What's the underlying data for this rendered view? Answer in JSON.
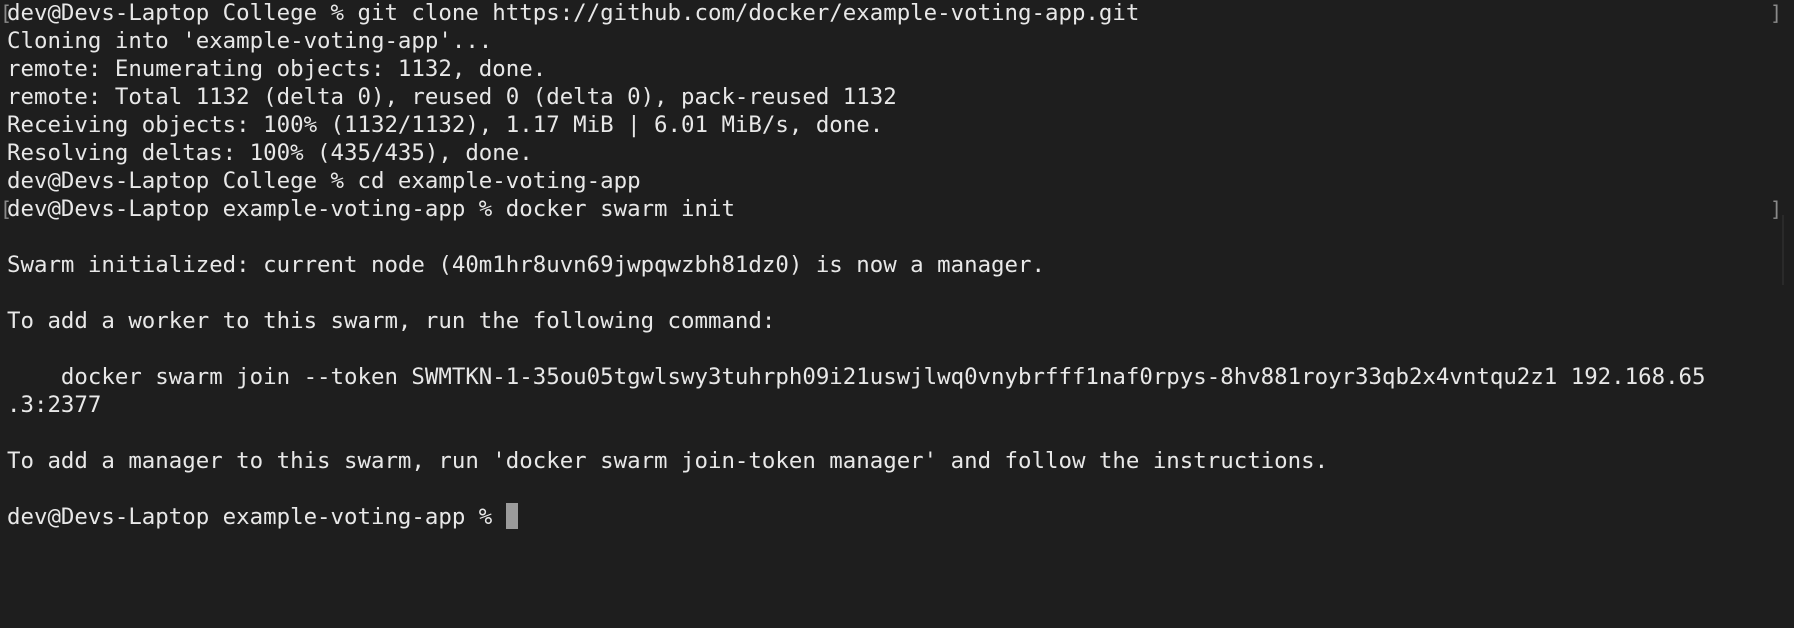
{
  "terminal": {
    "lines": [
      "dev@Devs-Laptop College % git clone https://github.com/docker/example-voting-app.git",
      "Cloning into 'example-voting-app'...",
      "remote: Enumerating objects: 1132, done.",
      "remote: Total 1132 (delta 0), reused 0 (delta 0), pack-reused 1132",
      "Receiving objects: 100% (1132/1132), 1.17 MiB | 6.01 MiB/s, done.",
      "Resolving deltas: 100% (435/435), done.",
      "dev@Devs-Laptop College % cd example-voting-app",
      "dev@Devs-Laptop example-voting-app % docker swarm init",
      "",
      "Swarm initialized: current node (40m1hr8uvn69jwpqwzbh81dz0) is now a manager.",
      "",
      "To add a worker to this swarm, run the following command:",
      "",
      "    docker swarm join --token SWMTKN-1-35ou05tgwlswy3tuhrph09i21uswjlwq0vnybrfff1naf0rpys-8hv881royr33qb2x4vntqu2z1 192.168.65",
      ".3:2377",
      "",
      "To add a manager to this swarm, run 'docker swarm join-token manager' and follow the instructions.",
      "",
      "dev@Devs-Laptop example-voting-app % "
    ],
    "mark_left": "[",
    "mark_right": "]",
    "colors": {
      "background": "#1e1e1e",
      "text": "#e8e8e8",
      "cursor": "#9b9b9b"
    }
  }
}
